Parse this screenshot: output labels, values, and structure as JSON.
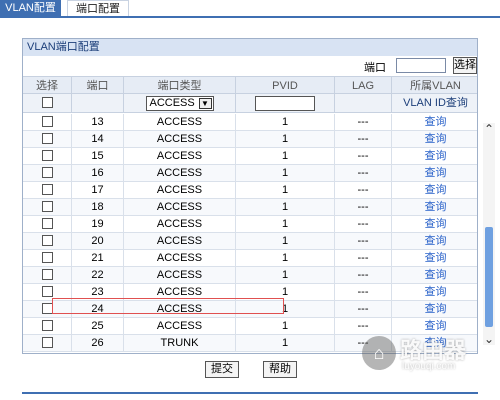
{
  "tabs": [
    {
      "label": "VLAN配置",
      "active": false
    },
    {
      "label": "端口配置",
      "active": true
    }
  ],
  "panel": {
    "title": "VLAN端口配置",
    "filter": {
      "label": "端口",
      "value": "",
      "button": "选择"
    }
  },
  "table": {
    "headers": [
      "选择",
      "端口",
      "端口类型",
      "PVID",
      "LAG",
      "所属VLAN"
    ],
    "select_row": {
      "type_value": "ACCESS",
      "pvid_value": "",
      "vlan_text": "VLAN ID查询"
    },
    "rows": [
      {
        "port": "13",
        "type": "ACCESS",
        "pvid": "1",
        "lag": "---",
        "vlan": "查询"
      },
      {
        "port": "14",
        "type": "ACCESS",
        "pvid": "1",
        "lag": "---",
        "vlan": "查询"
      },
      {
        "port": "15",
        "type": "ACCESS",
        "pvid": "1",
        "lag": "---",
        "vlan": "查询"
      },
      {
        "port": "16",
        "type": "ACCESS",
        "pvid": "1",
        "lag": "---",
        "vlan": "查询"
      },
      {
        "port": "17",
        "type": "ACCESS",
        "pvid": "1",
        "lag": "---",
        "vlan": "查询"
      },
      {
        "port": "18",
        "type": "ACCESS",
        "pvid": "1",
        "lag": "---",
        "vlan": "查询"
      },
      {
        "port": "19",
        "type": "ACCESS",
        "pvid": "1",
        "lag": "---",
        "vlan": "查询"
      },
      {
        "port": "20",
        "type": "ACCESS",
        "pvid": "1",
        "lag": "---",
        "vlan": "查询"
      },
      {
        "port": "21",
        "type": "ACCESS",
        "pvid": "1",
        "lag": "---",
        "vlan": "查询"
      },
      {
        "port": "22",
        "type": "ACCESS",
        "pvid": "1",
        "lag": "---",
        "vlan": "查询"
      },
      {
        "port": "23",
        "type": "ACCESS",
        "pvid": "1",
        "lag": "---",
        "vlan": "查询"
      },
      {
        "port": "24",
        "type": "ACCESS",
        "pvid": "1",
        "lag": "---",
        "vlan": "查询"
      },
      {
        "port": "25",
        "type": "ACCESS",
        "pvid": "1",
        "lag": "---",
        "vlan": "查询"
      },
      {
        "port": "26",
        "type": "TRUNK",
        "pvid": "1",
        "lag": "---",
        "vlan": "查询"
      }
    ]
  },
  "buttons": {
    "submit": "提交",
    "help": "帮助"
  },
  "watermark": {
    "text": "路由器",
    "sub": "luyouqi.com"
  },
  "colors": {
    "accent": "#3f6fb2",
    "link": "#2a62c9",
    "highlight": "#e05050",
    "scroll_thumb": "#6fa0e0"
  },
  "icons": {
    "select_arrow": "chevron-down-icon",
    "scroll_up": "chevron-up-icon",
    "scroll_down": "chevron-down-icon"
  }
}
